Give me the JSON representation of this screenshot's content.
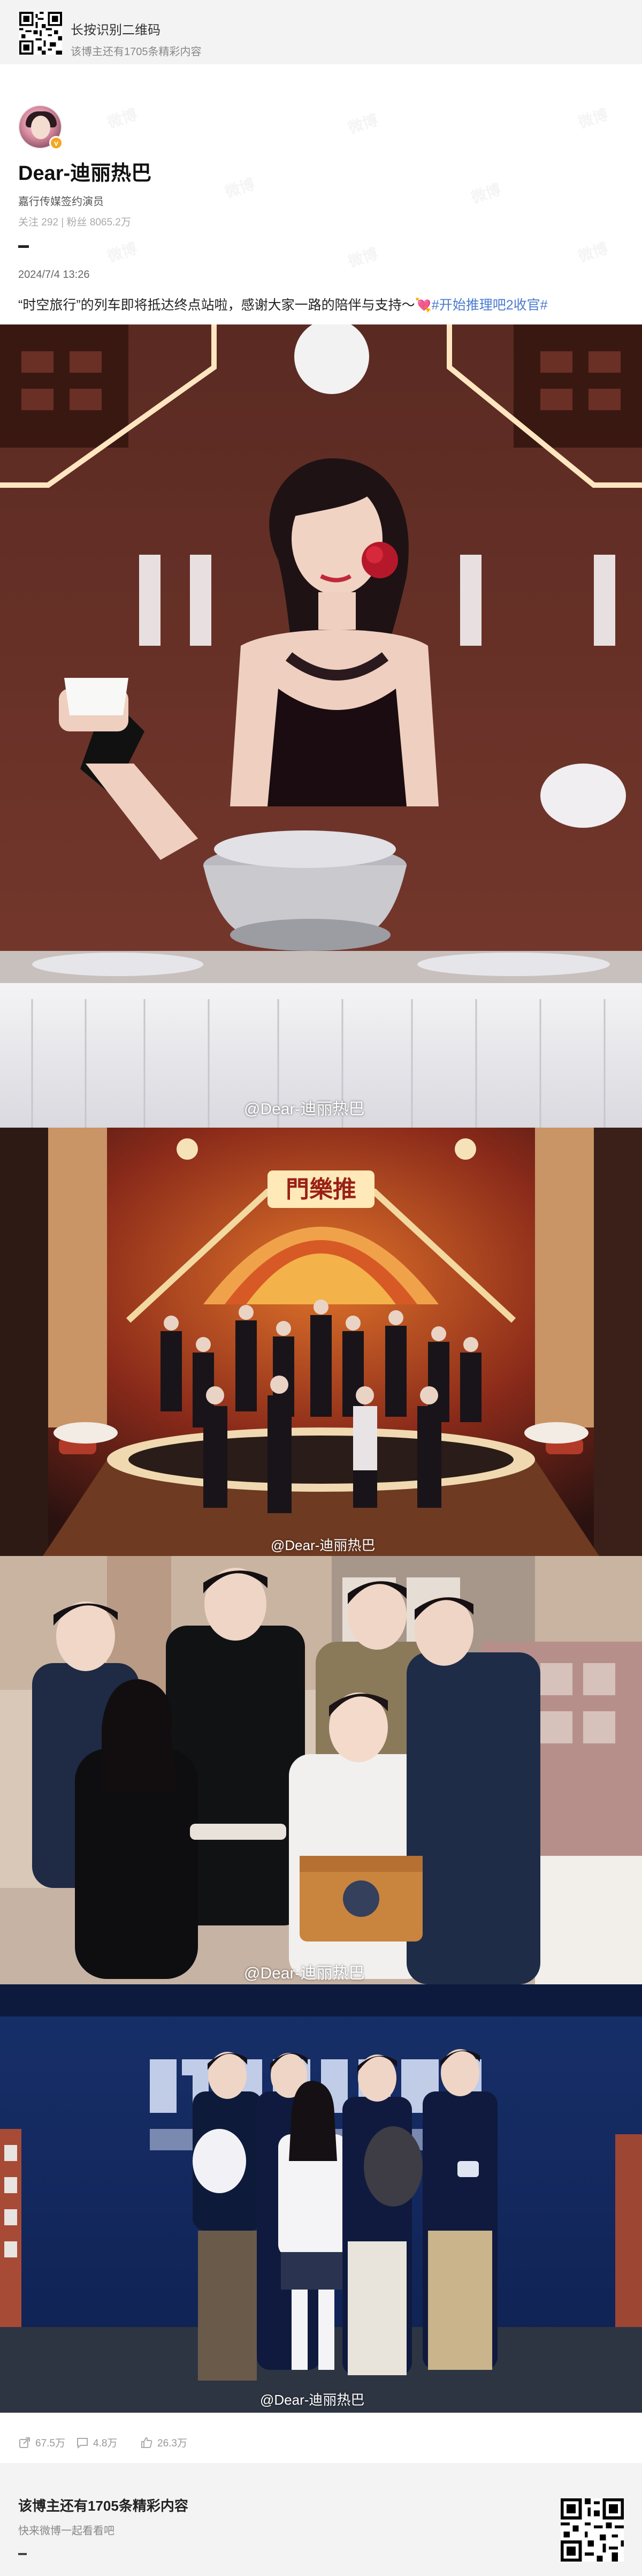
{
  "top_banner": {
    "title": "长按识别二维码",
    "subtitle": "该博主还有1705条精彩内容",
    "qr_icon": "qr-code-icon"
  },
  "profile": {
    "name": "Dear-迪丽热巴",
    "description": "嘉行传媒签约演员",
    "stats": "关注 292 | 粉丝 8065.2万",
    "verify_icon": "verified-badge-icon",
    "verify_color": "#f5a623"
  },
  "post": {
    "time": "2024/7/4 13:26",
    "text": "“时空旅行”的列车即将抵达终点站啦，感谢大家一路的陪伴与支持～",
    "heart": "💘",
    "hashtag": "#开始推理吧2收官#",
    "hashtag_color": "#4a7bd0"
  },
  "photos": [
    {
      "watermark": "@Dear-迪丽热巴"
    },
    {
      "watermark": "@Dear-迪丽热巴"
    },
    {
      "watermark": "@Dear-迪丽热巴"
    },
    {
      "watermark": "@Dear-迪丽热巴"
    }
  ],
  "sign": {
    "text": "門樂推"
  },
  "actions": {
    "share": {
      "icon": "share-icon",
      "count": "67.5万"
    },
    "comment": {
      "icon": "comment-icon",
      "count": "4.8万"
    },
    "like": {
      "icon": "thumbs-up-icon",
      "count": "26.3万"
    }
  },
  "bottom_banner": {
    "title": "该博主还有1705条精彩内容",
    "subtitle": "快来微博一起看看吧",
    "qr_icon": "qr-code-icon"
  }
}
